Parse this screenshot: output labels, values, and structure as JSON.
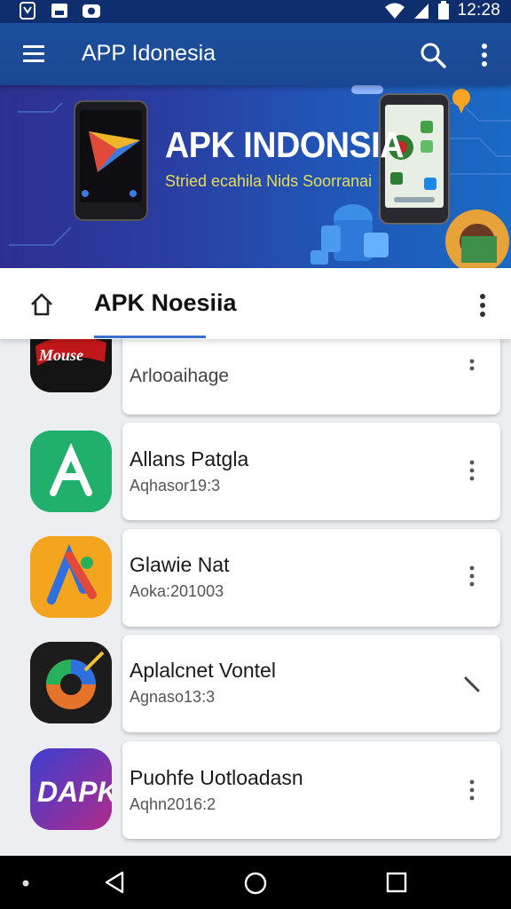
{
  "status_bar": {
    "time": "12:28"
  },
  "app_bar": {
    "title": "APP Idonesia"
  },
  "banner": {
    "title": "APK INDONSIA",
    "subtitle": "Stried ecahila Nids Soorranai"
  },
  "tab_bar": {
    "tab_label": "APK Noesiia"
  },
  "apps": [
    {
      "name": "",
      "subtitle": "Arlooaihage",
      "icon_name": "red-logo-app-icon"
    },
    {
      "name": "Allans Patgla",
      "subtitle": "Aqhasor19:3",
      "icon_name": "green-a-app-icon"
    },
    {
      "name": "Glawie Nat",
      "subtitle": "Aoka:201003",
      "icon_name": "orange-a-app-icon"
    },
    {
      "name": "Aplalcnet Vontel",
      "subtitle": "Agnaso13:3",
      "icon_name": "target-app-icon"
    },
    {
      "name": "Puohfe Uotloadasn",
      "subtitle": "Aqhn2016:2",
      "icon_name": "dapk-app-icon"
    }
  ],
  "icons": {
    "status_left": [
      "notification-icon",
      "image-icon",
      "camera-icon"
    ],
    "status_right": [
      "wifi-icon",
      "signal-icon",
      "battery-icon"
    ],
    "app_bar": [
      "menu-icon",
      "search-icon",
      "more-vert-icon"
    ],
    "nav": [
      "dot-icon",
      "back-icon",
      "home-circle-icon",
      "recents-icon"
    ]
  },
  "colors": {
    "primary": "#1b4893",
    "accent_indicator": "#3a6fd0",
    "banner_subtitle": "#e9dd55"
  }
}
